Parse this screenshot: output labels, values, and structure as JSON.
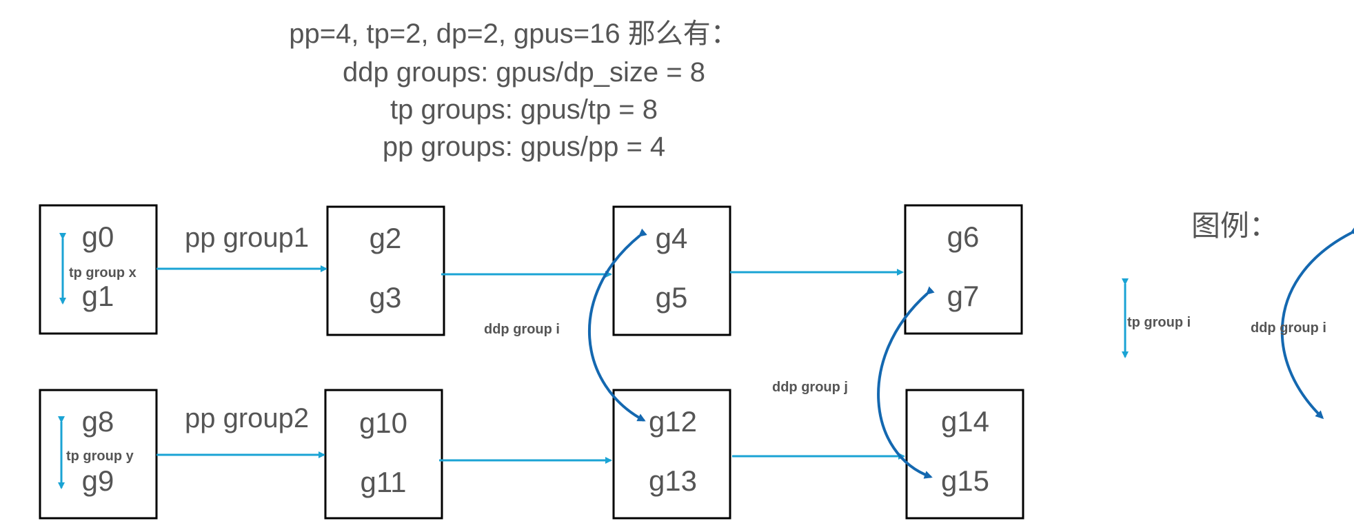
{
  "header": {
    "line1": "pp=4, tp=2, dp=2, gpus=16 那么有：",
    "line2": "ddp groups: gpus/dp_size = 8",
    "line3": "tp groups: gpus/tp = 8",
    "line4": "pp groups: gpus/pp = 4"
  },
  "boxes": [
    {
      "top": "g0",
      "bottom": "g1"
    },
    {
      "top": "g2",
      "bottom": "g3"
    },
    {
      "top": "g4",
      "bottom": "g5"
    },
    {
      "top": "g6",
      "bottom": "g7"
    },
    {
      "top": "g8",
      "bottom": "g9"
    },
    {
      "top": "g10",
      "bottom": "g11"
    },
    {
      "top": "g12",
      "bottom": "g13"
    },
    {
      "top": "g14",
      "bottom": "g15"
    }
  ],
  "labels": {
    "tp_x": "tp group x",
    "tp_y": "tp group y",
    "pp1": "pp group1",
    "pp2": "pp group2",
    "ddp_i": "ddp group i",
    "ddp_j": "ddp group j"
  },
  "legend": {
    "title": "图例：",
    "tp": "tp group i",
    "ddp": "ddp group i"
  },
  "colors": {
    "pp_arrow": "#1aa3d4",
    "ddp_arrow": "#1468b0",
    "text": "#555555"
  }
}
